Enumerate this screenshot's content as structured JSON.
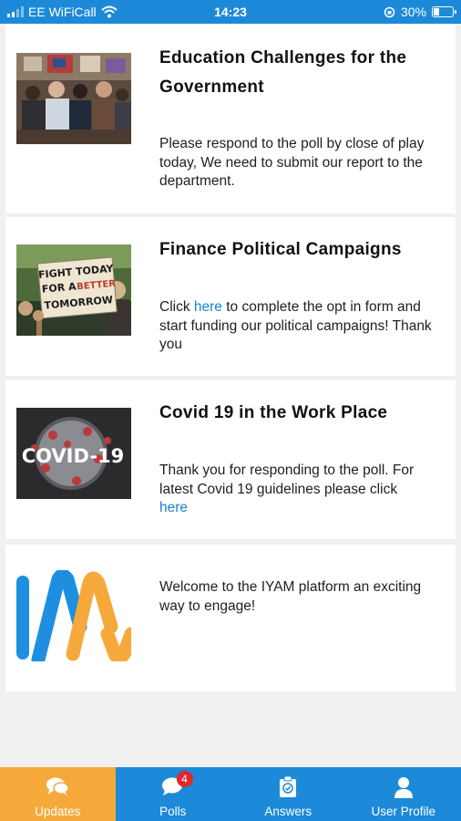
{
  "status_bar": {
    "carrier": "EE WiFiCall",
    "time": "14:23",
    "battery": "30%",
    "battery_level": 0.3
  },
  "feed": {
    "items": [
      {
        "title": "Education Challenges for the Government",
        "body": "Please respond to the poll by close of play today, We need to submit our report to the department.",
        "image": "protest-crowd-photo"
      },
      {
        "title": "Finance Political Campaigns",
        "body_before": "Click ",
        "link": "here",
        "body_after": " to complete the opt in form and start funding our political campaigns! Thank you",
        "image": "protest-sign-photo",
        "sign_text": [
          "FIGHT TODAY",
          "FOR A",
          "BETTER",
          "TOMORROW"
        ]
      },
      {
        "title": "Covid 19 in the Work Place",
        "body": "Thank you for responding to the poll. For latest Covid 19 guidelines please click",
        "link": "here",
        "image": "covid-virus-photo",
        "image_text": "COVID-19"
      },
      {
        "body": "Welcome to the IYAM platform an exciting way to engage!",
        "image": "iyam-logo"
      }
    ]
  },
  "nav": {
    "items": [
      {
        "label": "Updates",
        "icon": "chat-bubbles-icon",
        "active": true
      },
      {
        "label": "Polls",
        "icon": "poll-chat-icon",
        "badge": "4"
      },
      {
        "label": "Answers",
        "icon": "clipboard-check-icon"
      },
      {
        "label": "User Profile",
        "icon": "user-icon"
      }
    ]
  },
  "colors": {
    "primary": "#1c8ad8",
    "accent": "#f6a93b",
    "link": "#1a7fd4",
    "badge": "#e3262b"
  }
}
